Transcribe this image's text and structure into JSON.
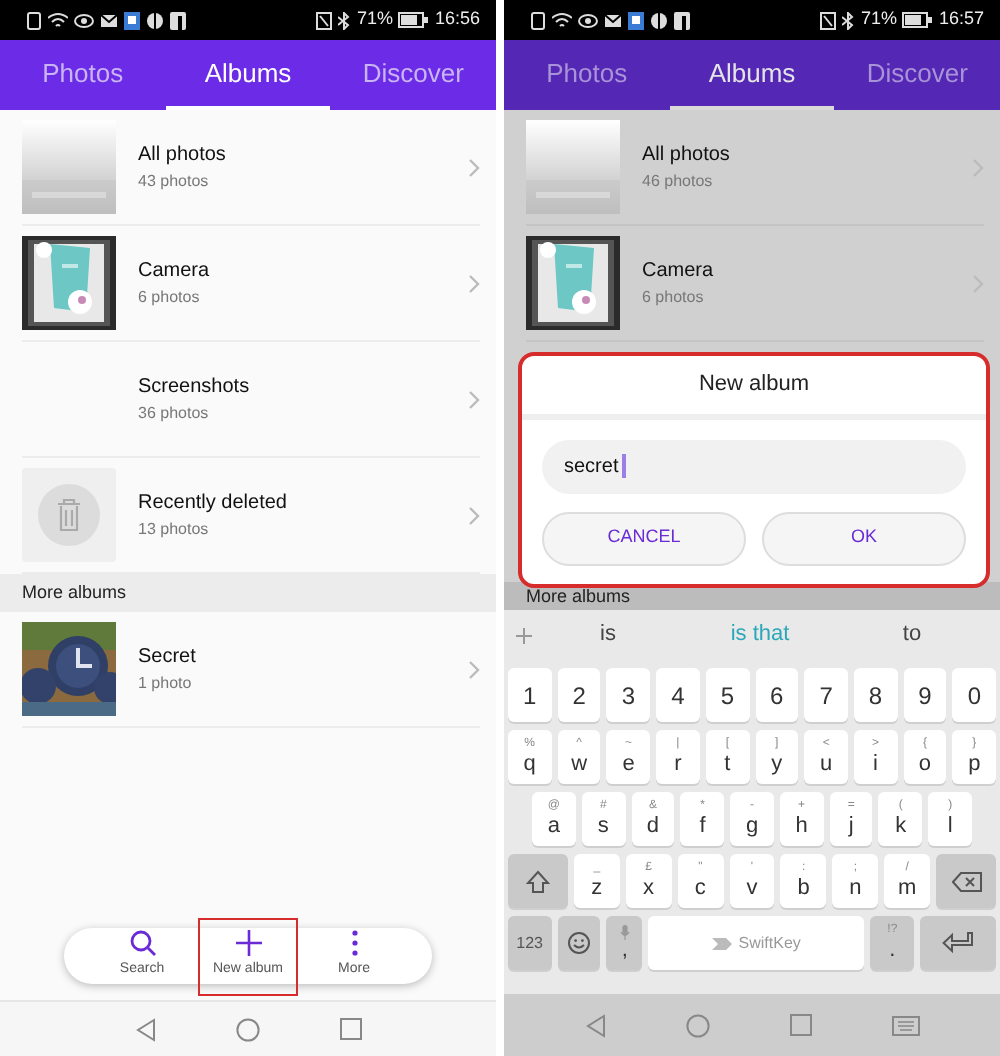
{
  "screens": [
    {
      "dimmed": false,
      "status_bar": {
        "battery": "71%",
        "time": "16:56"
      },
      "tabs": [
        {
          "label": "Photos",
          "selected": false
        },
        {
          "label": "Albums",
          "selected": true
        },
        {
          "label": "Discover",
          "selected": false
        }
      ],
      "albums": [
        {
          "kind": "gradient",
          "title": "All photos",
          "subtitle": "43 photos"
        },
        {
          "kind": "camera",
          "title": "Camera",
          "subtitle": "6 photos"
        },
        {
          "kind": "blank",
          "title": "Screenshots",
          "subtitle": "36 photos"
        },
        {
          "kind": "bin",
          "title": "Recently deleted",
          "subtitle": "13 photos"
        }
      ],
      "section_header": "More albums",
      "more_albums": [
        {
          "kind": "clocks",
          "title": "Secret",
          "subtitle": "1 photo"
        }
      ],
      "bottom_bar": [
        {
          "kind": "search",
          "label": "Search",
          "highlighted": false
        },
        {
          "kind": "add",
          "label": "New album",
          "highlighted": true
        },
        {
          "kind": "more",
          "label": "More",
          "highlighted": false
        }
      ]
    },
    {
      "dimmed": true,
      "status_bar": {
        "battery": "71%",
        "time": "16:57"
      },
      "tabs": [
        {
          "label": "Photos",
          "selected": false
        },
        {
          "label": "Albums",
          "selected": true
        },
        {
          "label": "Discover",
          "selected": false
        }
      ],
      "albums": [
        {
          "kind": "gradient",
          "title": "All photos",
          "subtitle": "46 photos"
        },
        {
          "kind": "camera",
          "title": "Camera",
          "subtitle": "6 photos"
        }
      ],
      "section_header": "More albums",
      "dialog": {
        "title": "New album",
        "value": "secret",
        "highlighted": true,
        "buttons": [
          "CANCEL",
          "OK"
        ]
      },
      "keyboard": {
        "suggestions": [
          {
            "text": "is",
            "selected": false
          },
          {
            "text": "is that",
            "selected": true
          },
          {
            "text": "to",
            "selected": false
          }
        ],
        "rows": [
          [
            {
              "kind": "char",
              "label": "1"
            },
            {
              "kind": "char",
              "label": "2"
            },
            {
              "kind": "char",
              "label": "3"
            },
            {
              "kind": "char",
              "label": "4"
            },
            {
              "kind": "char",
              "label": "5"
            },
            {
              "kind": "char",
              "label": "6"
            },
            {
              "kind": "char",
              "label": "7"
            },
            {
              "kind": "char",
              "label": "8"
            },
            {
              "kind": "char",
              "label": "9"
            },
            {
              "kind": "char",
              "label": "0"
            }
          ],
          [
            {
              "kind": "char",
              "label": "q",
              "secondary": "%"
            },
            {
              "kind": "char",
              "label": "w",
              "secondary": "^"
            },
            {
              "kind": "char",
              "label": "e",
              "secondary": "~"
            },
            {
              "kind": "char",
              "label": "r",
              "secondary": "|"
            },
            {
              "kind": "char",
              "label": "t",
              "secondary": "["
            },
            {
              "kind": "char",
              "label": "y",
              "secondary": "]"
            },
            {
              "kind": "char",
              "label": "u",
              "secondary": "<"
            },
            {
              "kind": "char",
              "label": "i",
              "secondary": ">"
            },
            {
              "kind": "char",
              "label": "o",
              "secondary": "{"
            },
            {
              "kind": "char",
              "label": "p",
              "secondary": "}"
            }
          ],
          [
            {
              "kind": "char",
              "label": "a",
              "secondary": "@"
            },
            {
              "kind": "char",
              "label": "s",
              "secondary": "#"
            },
            {
              "kind": "char",
              "label": "d",
              "secondary": "&"
            },
            {
              "kind": "char",
              "label": "f",
              "secondary": "*"
            },
            {
              "kind": "char",
              "label": "g",
              "secondary": "-"
            },
            {
              "kind": "char",
              "label": "h",
              "secondary": "+"
            },
            {
              "kind": "char",
              "label": "j",
              "secondary": "="
            },
            {
              "kind": "char",
              "label": "k",
              "secondary": "("
            },
            {
              "kind": "char",
              "label": "l",
              "secondary": ")"
            }
          ],
          [
            {
              "kind": "shift"
            },
            {
              "kind": "char",
              "label": "z",
              "secondary": "_"
            },
            {
              "kind": "char",
              "label": "x",
              "secondary": "£"
            },
            {
              "kind": "char",
              "label": "c",
              "secondary": "\""
            },
            {
              "kind": "char",
              "label": "v",
              "secondary": "'"
            },
            {
              "kind": "char",
              "label": "b",
              "secondary": ":"
            },
            {
              "kind": "char",
              "label": "n",
              "secondary": ";"
            },
            {
              "kind": "char",
              "label": "m",
              "secondary": "/"
            },
            {
              "kind": "backspace"
            }
          ],
          [
            {
              "kind": "mode",
              "label": "123"
            },
            {
              "kind": "emoji"
            },
            {
              "kind": "comma",
              "label": ","
            },
            {
              "kind": "space",
              "label": "SwiftKey"
            },
            {
              "kind": "period",
              "label": ".",
              "secondary": "!?"
            },
            {
              "kind": "enter"
            }
          ]
        ]
      }
    }
  ]
}
